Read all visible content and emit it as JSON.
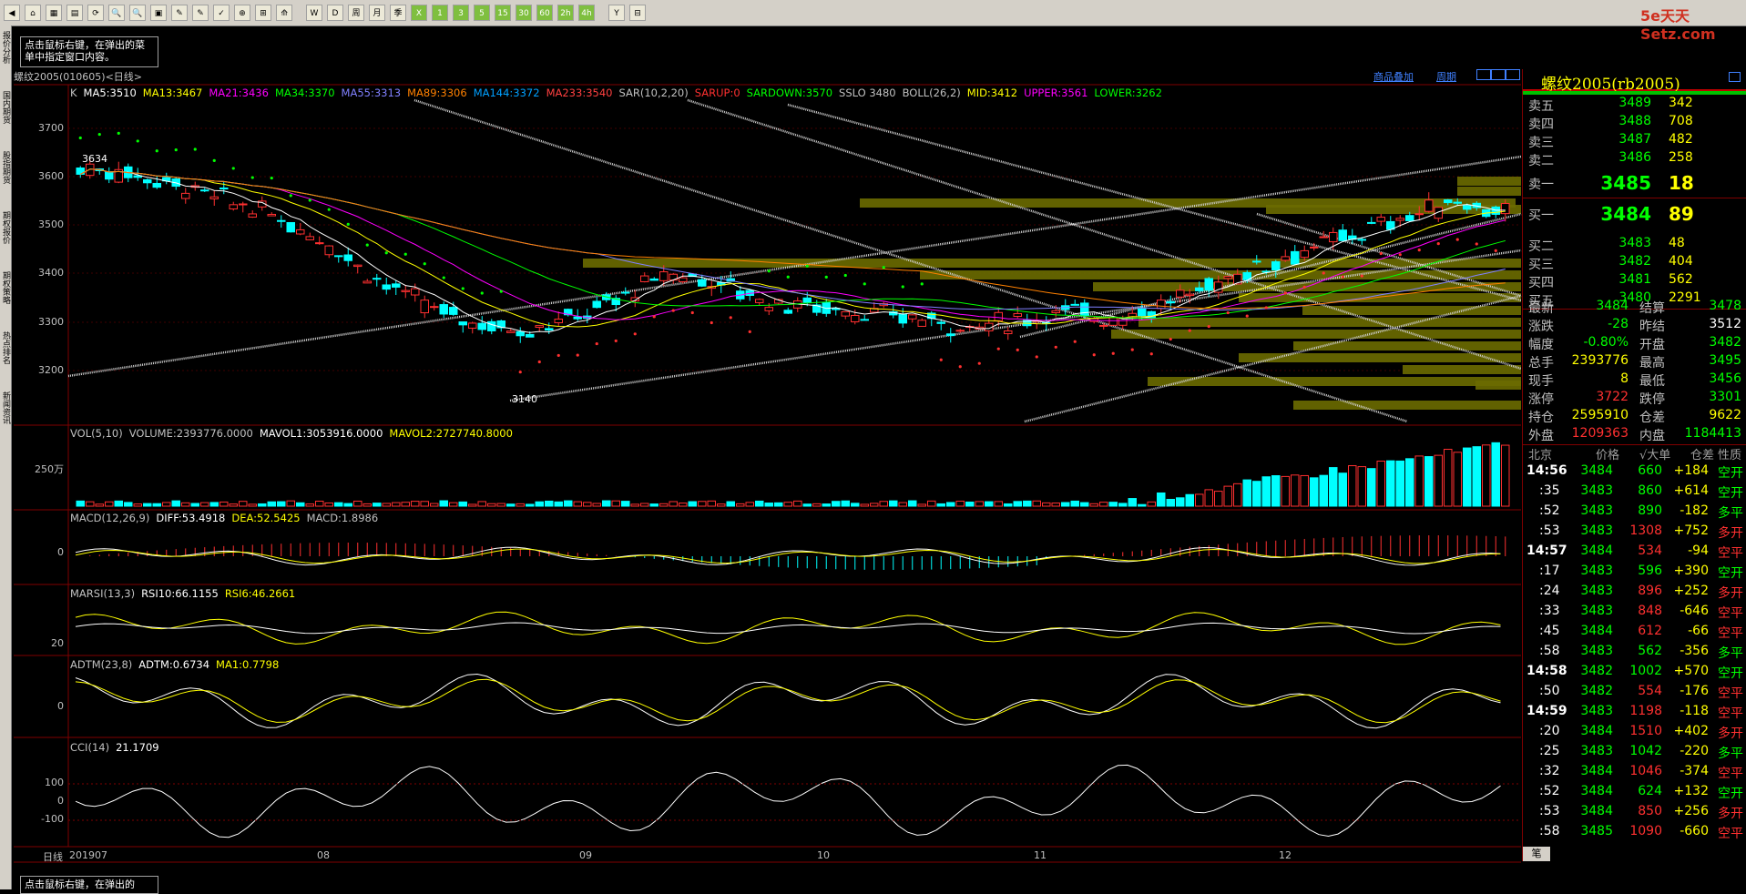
{
  "toolbar": {
    "buttons": [
      "◀",
      "⌂",
      "▦",
      "▤",
      "⟳",
      "🔍",
      "🔍",
      "▣",
      "✎",
      "✎",
      "✓",
      "⊕",
      "⊞",
      "⟰",
      "W",
      "D",
      "周",
      "月",
      "季",
      "X",
      "1",
      "3",
      "5",
      "15",
      "30",
      "60",
      "2h",
      "4h",
      "Y",
      "⊟"
    ]
  },
  "logo": "5e天天 Setz.com",
  "sidebar": {
    "tabs": [
      "报价分析",
      "国内期货",
      "股指期货",
      "期权报价",
      "期权策略",
      "热点排名",
      "新闻资讯"
    ]
  },
  "tip": "点击鼠标右键，在弹出的菜单中指定窗口内容。",
  "tip_bottom": "点击鼠标右键，在弹出的",
  "chart_title": "螺纹2005(010605)<日线>",
  "header_links": {
    "add": "商品叠加",
    "period": "周期"
  },
  "main_indicators": [
    {
      "t": "K",
      "c": "#c0c0c0"
    },
    {
      "t": "MA5:3510",
      "c": "#ffffff"
    },
    {
      "t": "MA13:3467",
      "c": "#ffff00"
    },
    {
      "t": "MA21:3436",
      "c": "#ff00ff"
    },
    {
      "t": "MA34:3370",
      "c": "#00ff00"
    },
    {
      "t": "MA55:3313",
      "c": "#8080ff"
    },
    {
      "t": "MA89:3306",
      "c": "#ff8000"
    },
    {
      "t": "MA144:3372",
      "c": "#00a0ff"
    },
    {
      "t": "MA233:3540",
      "c": "#ff4040"
    },
    {
      "t": "SAR(10,2,20)",
      "c": "#c0c0c0"
    },
    {
      "t": "SARUP:0",
      "c": "#ff3030"
    },
    {
      "t": "SARDOWN:3570",
      "c": "#00ff00"
    },
    {
      "t": "SSLO 3480",
      "c": "#c0c0c0"
    },
    {
      "t": "BOLL(26,2)",
      "c": "#c0c0c0"
    },
    {
      "t": "MID:3412",
      "c": "#ffff00"
    },
    {
      "t": "UPPER:3561",
      "c": "#ff00ff"
    },
    {
      "t": "LOWER:3262",
      "c": "#00ff00"
    }
  ],
  "price_axis": [
    "3700",
    "3600",
    "3500",
    "3400",
    "3300",
    "3200"
  ],
  "price_marks": {
    "high": "3634",
    "low": "3140"
  },
  "vol_panel": {
    "labels": [
      {
        "t": "VOL(5,10)",
        "c": "#c0c0c0"
      },
      {
        "t": "VOLUME:2393776.0000",
        "c": "#c0c0c0"
      },
      {
        "t": "MAVOL1:3053916.0000",
        "c": "#ffffff"
      },
      {
        "t": "MAVOL2:2727740.8000",
        "c": "#ffff00"
      }
    ],
    "axis": "250万"
  },
  "macd_panel": {
    "labels": [
      {
        "t": "MACD(12,26,9)",
        "c": "#c0c0c0"
      },
      {
        "t": "DIFF:53.4918",
        "c": "#ffffff"
      },
      {
        "t": "DEA:52.5425",
        "c": "#ffff00"
      },
      {
        "t": "MACD:1.8986",
        "c": "#c0c0c0"
      }
    ],
    "axis": "0"
  },
  "marsi_panel": {
    "labels": [
      {
        "t": "MARSI(13,3)",
        "c": "#c0c0c0"
      },
      {
        "t": "RSI10:66.1155",
        "c": "#ffffff"
      },
      {
        "t": "RSI6:46.2661",
        "c": "#ffff00"
      }
    ],
    "axis": "20"
  },
  "adtm_panel": {
    "labels": [
      {
        "t": "ADTM(23,8)",
        "c": "#c0c0c0"
      },
      {
        "t": "ADTM:0.6734",
        "c": "#ffffff"
      },
      {
        "t": "MA1:0.7798",
        "c": "#ffff00"
      }
    ],
    "axis": "0"
  },
  "cci_panel": {
    "labels": [
      {
        "t": "CCI(14)",
        "c": "#c0c0c0"
      },
      {
        "t": "21.1709",
        "c": "#ffffff"
      }
    ],
    "axis": [
      "100",
      "0",
      "-100"
    ]
  },
  "date_axis": {
    "label": "日线",
    "ticks": [
      "201907",
      "08",
      "09",
      "10",
      "11",
      "12"
    ]
  },
  "quote": {
    "name": "螺纹2005(rb2005)",
    "asks": [
      {
        "l": "卖五",
        "p": "3489",
        "v": "342"
      },
      {
        "l": "卖四",
        "p": "3488",
        "v": "708"
      },
      {
        "l": "卖三",
        "p": "3487",
        "v": "482"
      },
      {
        "l": "卖二",
        "p": "3486",
        "v": "258"
      }
    ],
    "ask1": {
      "l": "卖一",
      "p": "3485",
      "v": "18"
    },
    "bid1": {
      "l": "买一",
      "p": "3484",
      "v": "89"
    },
    "bids": [
      {
        "l": "买二",
        "p": "3483",
        "v": "48"
      },
      {
        "l": "买三",
        "p": "3482",
        "v": "404"
      },
      {
        "l": "买四",
        "p": "3481",
        "v": "562"
      },
      {
        "l": "买五",
        "p": "3480",
        "v": "2291"
      }
    ],
    "stats": [
      {
        "a": "最新",
        "av": "3484",
        "ac": "#00ff00",
        "b": "结算",
        "bv": "3478",
        "bc": "#00ff00"
      },
      {
        "a": "涨跌",
        "av": "-28",
        "ac": "#00ff00",
        "b": "昨结",
        "bv": "3512",
        "bc": "#ffffff"
      },
      {
        "a": "幅度",
        "av": "-0.80%",
        "ac": "#00ff00",
        "b": "开盘",
        "bv": "3482",
        "bc": "#00ff00"
      },
      {
        "a": "总手",
        "av": "2393776",
        "ac": "#ffff00",
        "b": "最高",
        "bv": "3495",
        "bc": "#00ff00"
      },
      {
        "a": "现手",
        "av": "8",
        "ac": "#ffff00",
        "b": "最低",
        "bv": "3456",
        "bc": "#00ff00"
      },
      {
        "a": "涨停",
        "av": "3722",
        "ac": "#ff3030",
        "b": "跌停",
        "bv": "3301",
        "bc": "#00ff00"
      },
      {
        "a": "持仓",
        "av": "2595910",
        "ac": "#ffff00",
        "b": "仓差",
        "bv": "9622",
        "bc": "#ffff00"
      },
      {
        "a": "外盘",
        "av": "1209363",
        "ac": "#ff3030",
        "b": "内盘",
        "bv": "1184413",
        "bc": "#00ff00"
      }
    ],
    "trade_header": [
      "北京",
      "价格",
      "√大单",
      "仓差",
      "性质"
    ],
    "trades": [
      {
        "t": "14:56",
        "p": "3484",
        "v": "660",
        "vc": "#00ff00",
        "d": "+184",
        "dc": "#ffff00",
        "n": "空开",
        "nc": "#00ff00"
      },
      {
        "t": ":35",
        "p": "3483",
        "v": "860",
        "vc": "#00ff00",
        "d": "+614",
        "dc": "#ffff00",
        "n": "空开",
        "nc": "#00ff00"
      },
      {
        "t": ":52",
        "p": "3483",
        "v": "890",
        "vc": "#00ff00",
        "d": "-182",
        "dc": "#ffff00",
        "n": "多平",
        "nc": "#00ff00"
      },
      {
        "t": ":53",
        "p": "3483",
        "v": "1308",
        "vc": "#ff3030",
        "d": "+752",
        "dc": "#ffff00",
        "n": "多开",
        "nc": "#ff3030"
      },
      {
        "t": "14:57",
        "p": "3484",
        "v": "534",
        "vc": "#ff3030",
        "d": "-94",
        "dc": "#ffff00",
        "n": "空平",
        "nc": "#ff3030"
      },
      {
        "t": ":17",
        "p": "3483",
        "v": "596",
        "vc": "#00ff00",
        "d": "+390",
        "dc": "#ffff00",
        "n": "空开",
        "nc": "#00ff00"
      },
      {
        "t": ":24",
        "p": "3483",
        "v": "896",
        "vc": "#ff3030",
        "d": "+252",
        "dc": "#ffff00",
        "n": "多开",
        "nc": "#ff3030"
      },
      {
        "t": ":33",
        "p": "3483",
        "v": "848",
        "vc": "#ff3030",
        "d": "-646",
        "dc": "#ffff00",
        "n": "空平",
        "nc": "#ff3030"
      },
      {
        "t": ":45",
        "p": "3484",
        "v": "612",
        "vc": "#ff3030",
        "d": "-66",
        "dc": "#ffff00",
        "n": "空平",
        "nc": "#ff3030"
      },
      {
        "t": ":58",
        "p": "3483",
        "v": "562",
        "vc": "#00ff00",
        "d": "-356",
        "dc": "#ffff00",
        "n": "多平",
        "nc": "#00ff00"
      },
      {
        "t": "14:58",
        "p": "3482",
        "v": "1002",
        "vc": "#00ff00",
        "d": "+570",
        "dc": "#ffff00",
        "n": "空开",
        "nc": "#00ff00"
      },
      {
        "t": ":50",
        "p": "3482",
        "v": "554",
        "vc": "#ff3030",
        "d": "-176",
        "dc": "#ffff00",
        "n": "空平",
        "nc": "#ff3030"
      },
      {
        "t": "14:59",
        "p": "3483",
        "v": "1198",
        "vc": "#ff3030",
        "d": "-118",
        "dc": "#ffff00",
        "n": "空平",
        "nc": "#ff3030"
      },
      {
        "t": ":20",
        "p": "3484",
        "v": "1510",
        "vc": "#ff3030",
        "d": "+402",
        "dc": "#ffff00",
        "n": "多开",
        "nc": "#ff3030"
      },
      {
        "t": ":25",
        "p": "3483",
        "v": "1042",
        "vc": "#00ff00",
        "d": "-220",
        "dc": "#ffff00",
        "n": "多平",
        "nc": "#00ff00"
      },
      {
        "t": ":32",
        "p": "3484",
        "v": "1046",
        "vc": "#ff3030",
        "d": "-374",
        "dc": "#ffff00",
        "n": "空平",
        "nc": "#ff3030"
      },
      {
        "t": ":52",
        "p": "3484",
        "v": "624",
        "vc": "#00ff00",
        "d": "+132",
        "dc": "#ffff00",
        "n": "空开",
        "nc": "#00ff00"
      },
      {
        "t": ":53",
        "p": "3484",
        "v": "850",
        "vc": "#ff3030",
        "d": "+256",
        "dc": "#ffff00",
        "n": "多开",
        "nc": "#ff3030"
      },
      {
        "t": ":58",
        "p": "3485",
        "v": "1090",
        "vc": "#ff3030",
        "d": "-660",
        "dc": "#ffff00",
        "n": "空平",
        "nc": "#ff3030"
      }
    ],
    "footer_tab": "笔"
  }
}
